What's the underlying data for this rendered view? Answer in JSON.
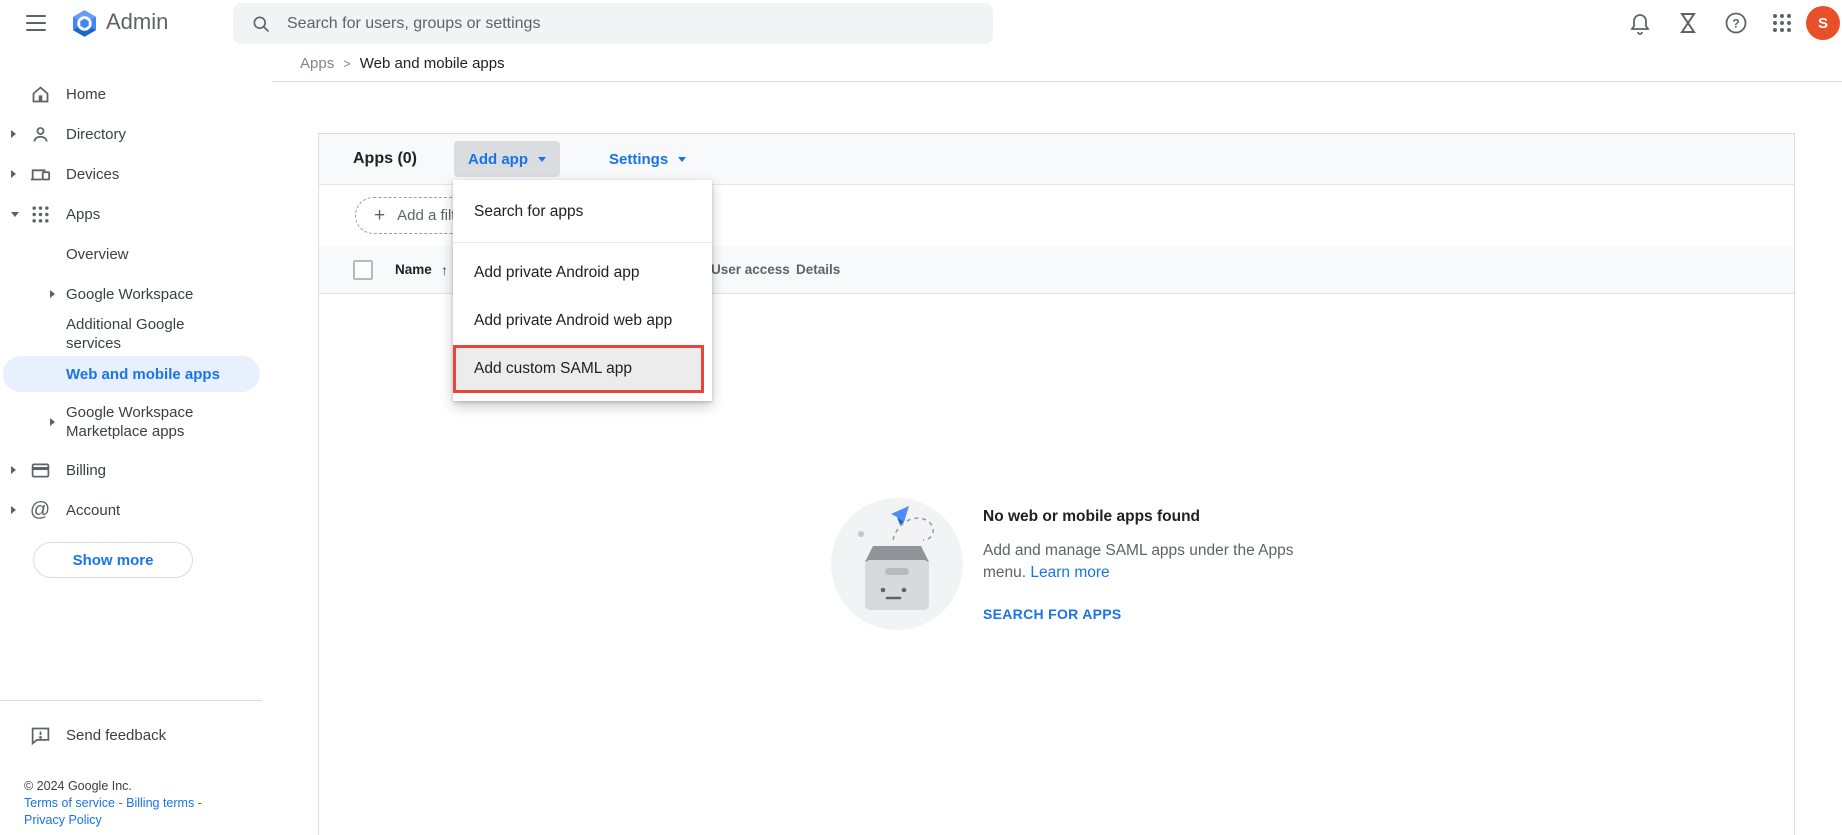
{
  "colors": {
    "accent": "#1a73e8",
    "selected_bg": "#e8f0fe",
    "annotation": "#e8453b",
    "avatar_bg": "#e8502a"
  },
  "topbar": {
    "product": "Admin",
    "search_placeholder": "Search for users, groups or settings",
    "avatar_letter": "S"
  },
  "breadcrumb": {
    "parent": "Apps",
    "separator": ">",
    "current": "Web and mobile apps"
  },
  "sidebar": {
    "items": [
      {
        "label": "Home"
      },
      {
        "label": "Directory"
      },
      {
        "label": "Devices"
      },
      {
        "label": "Apps"
      },
      {
        "label": "Overview"
      },
      {
        "label": "Google Workspace"
      },
      {
        "label": "Additional Google services"
      },
      {
        "label": "Web and mobile apps"
      },
      {
        "label": "Google Workspace Marketplace apps"
      },
      {
        "label": "Billing"
      },
      {
        "label": "Account"
      }
    ],
    "show_more_label": "Show more",
    "send_feedback_label": "Send feedback",
    "footer": {
      "copyright": "© 2024 Google Inc.",
      "links": [
        "Terms of service",
        "Billing terms",
        "Privacy Policy"
      ],
      "separator": "-"
    }
  },
  "toolbar": {
    "title": "Apps (0)",
    "add_app_label": "Add app",
    "settings_label": "Settings"
  },
  "filter": {
    "add_filter_label": "Add a filter",
    "plus_glyph": "+"
  },
  "table": {
    "columns": [
      "Name",
      "User access",
      "Details"
    ],
    "sort_glyph": "↑"
  },
  "menu": {
    "items": [
      "Search for apps",
      "Add private Android app",
      "Add private Android web app",
      "Add custom SAML app"
    ],
    "highlighted_item": "Add custom SAML app"
  },
  "empty_state": {
    "title": "No web or mobile apps found",
    "description": "Add and manage SAML apps under the Apps menu.",
    "learn_more_label": "Learn more",
    "action_label": "SEARCH FOR APPS"
  }
}
